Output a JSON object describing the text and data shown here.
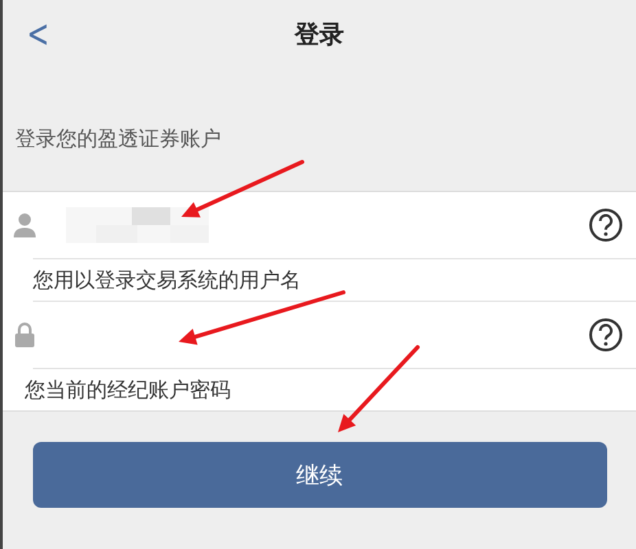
{
  "header": {
    "back": "<",
    "title": "登录"
  },
  "subtitle": "登录您的盈透证券账户",
  "fields": [
    {
      "kind": "username",
      "hint": "您用以登录交易系统的用户名"
    },
    {
      "kind": "password",
      "hint": "您当前的经纪账户密码"
    }
  ],
  "button": "继续"
}
